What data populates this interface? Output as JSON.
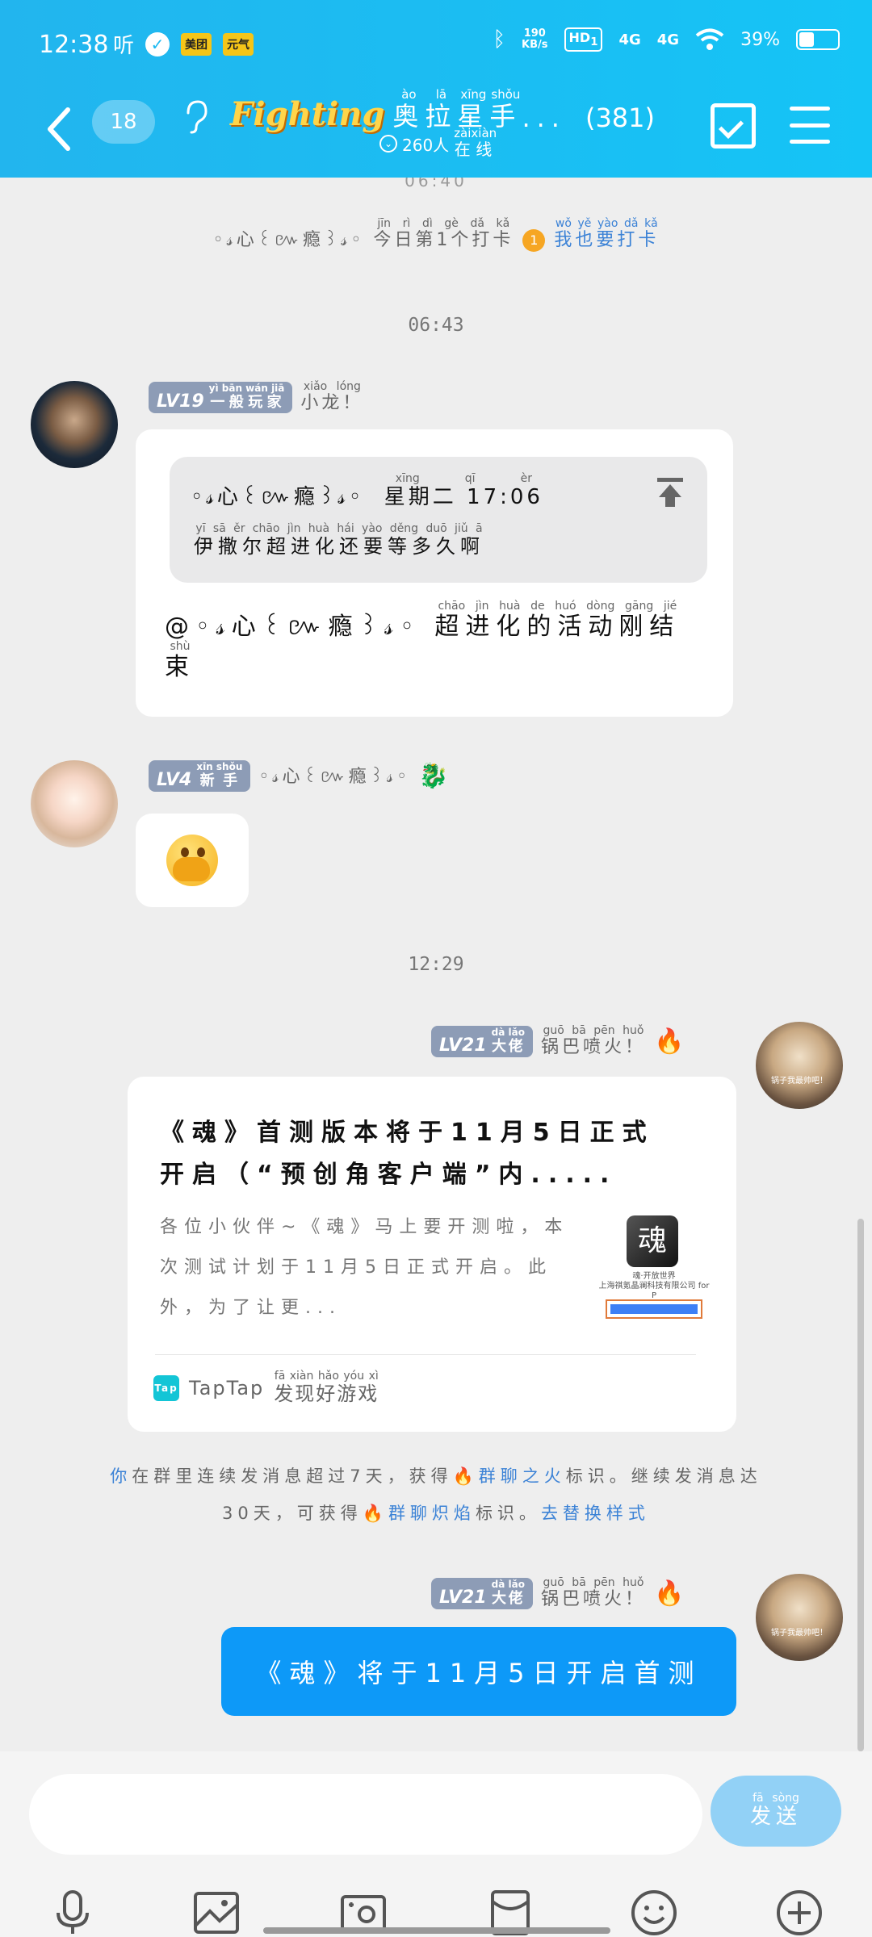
{
  "status_bar": {
    "time": "12:38",
    "listen_label": "听",
    "badge_meituan": "美团",
    "badge_yuanqi": "元气",
    "net_speed_value": "190",
    "net_speed_unit": "KB/s",
    "hd_label": "HD",
    "hd_sub": "1",
    "sig1": "4G",
    "sig2": "4G",
    "battery": "39%"
  },
  "header": {
    "unread_count": "18",
    "logo_text": "Fighting",
    "group_name": [
      {
        "c": "奥",
        "p": "ào"
      },
      {
        "c": "拉",
        "p": "lā"
      },
      {
        "c": "星",
        "p": "xīng"
      },
      {
        "c": "手",
        "p": "shǒu"
      }
    ],
    "group_name_ellipsis": "...",
    "member_count": "(381)",
    "online_count": "260人",
    "online_suffix": [
      {
        "c": "在",
        "p": "zài"
      },
      {
        "c": "线",
        "p": "xiàn"
      }
    ]
  },
  "chat": {
    "partial_time": "06:40",
    "checkin": {
      "user": "◦𝓈心꒰៚瘾꒱𝓈◦",
      "text": "今日第1个打卡",
      "text_pinyin": "jīn rì dì gè dǎ kǎ",
      "rank_badge": "1",
      "action": "我也要打卡",
      "action_pinyin": "wǒ yě yào dǎ kǎ"
    },
    "time1": "06:43",
    "msg1": {
      "level": "LV19",
      "level_title": "一般玩家",
      "level_title_pinyin": "yì bān wán jiā",
      "name": "小龙！",
      "name_pinyin": "xiǎo lóng",
      "quote_user": "◦𝓈心꒰៚瘾꒱𝓈◦",
      "quote_time": "星期二 17:06",
      "quote_time_pinyin": "xīng qī èr",
      "quote_text": "伊撒尔超进化还要等多久啊",
      "quote_text_pinyin": "yī sā ěr chāo jìn huà hái yào děng duō jiǔ ā",
      "mention_prefix": "@◦𝓈心꒰៚瘾꒱𝓈◦",
      "mention_text": "超进化的活动刚结束",
      "mention_text_pinyin": "chāo jìn huà de huó dòng gāng jié shù"
    },
    "msg2": {
      "level": "LV4",
      "level_title": "新手",
      "level_title_pinyin": "xīn shǒu",
      "name": "◦𝓈心꒰៚瘾꒱𝓈◦"
    },
    "time2": "12:29",
    "msg3": {
      "level": "LV21",
      "level_title": "大佬",
      "level_title_pinyin": "dà lǎo",
      "name": "锅巴喷火！",
      "name_pinyin": "guō bā pēn huǒ",
      "card_title": "《魂》首测版本将于11月5日正式开启（“预创角客户端”内.....",
      "card_desc": "各位小伙伴~《魂》马上要开测啦，本次测试计划于11月5日正式开启。此外，为了让更...",
      "thumb_caption": "魂·开放世界\n上海祺氪晶澜科技有限公司 for P",
      "source_logo": "Tap",
      "source_name": "TapTap",
      "source_slogan": "发现好游戏",
      "source_slogan_pinyin": "fā xiàn hǎo yóu xì",
      "avatar_caption": "锅子我最帅吧！"
    },
    "fire_notice": {
      "line1a": "你",
      "line1b": "在群里连续发消息超过7天，获得",
      "badge1": "群聊之火",
      "line1c": "标识。继续发消息达",
      "line2a": "30天，可获得",
      "badge2": "群聊炽焰",
      "line2b": "标识。",
      "action": "去替换样式"
    },
    "msg4": {
      "level": "LV21",
      "level_title": "大佬",
      "level_title_pinyin": "dà lǎo",
      "name": "锅巴喷火！",
      "name_pinyin": "guō bā pēn huǒ",
      "text": "《魂》将于11月5日开启首测",
      "avatar_caption": "锅子我最帅吧！"
    }
  },
  "input": {
    "placeholder": "",
    "send_label": "发送",
    "send_pinyin": "fā sòng"
  },
  "toolbar": [
    "mic-icon",
    "image-icon",
    "camera-icon",
    "red-packet-icon",
    "emoji-icon",
    "plus-icon"
  ],
  "colors": {
    "header": "#1bbdf3",
    "accent_blue": "#0d99f8",
    "link_blue": "#3b82d6",
    "level_badge": "#8d9cb6"
  }
}
